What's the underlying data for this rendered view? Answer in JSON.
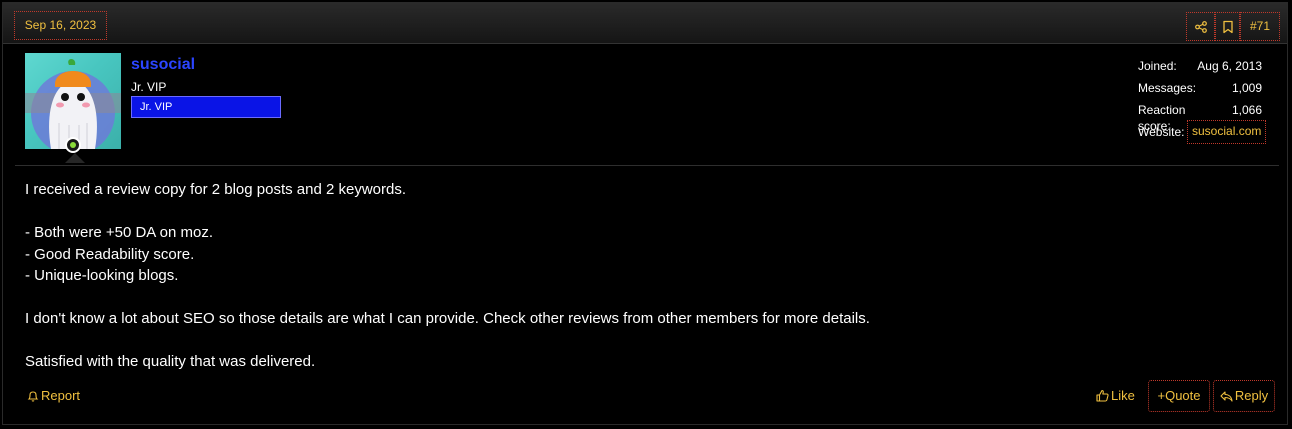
{
  "post": {
    "date": "Sep 16, 2023",
    "number": "#71",
    "share_icon": "share-icon",
    "bookmark_icon": "bookmark-icon"
  },
  "user": {
    "name": "susocial",
    "title": "Jr. VIP",
    "banner": "Jr. VIP",
    "online": true,
    "stats": {
      "joined_label": "Joined:",
      "joined_value": "Aug 6, 2013",
      "messages_label": "Messages:",
      "messages_value": "1,009",
      "reaction_label": "Reaction score:",
      "reaction_value": "1,066",
      "website_label": "Website:",
      "website_value": "susocial.com"
    }
  },
  "message": {
    "lines": [
      "I received a review copy for 2 blog posts and 2 keywords.",
      "",
      "- Both were +50 DA on moz.",
      "- Good Readability score.",
      "- Unique-looking blogs.",
      "",
      "I don't know a lot about SEO so those details are what I can provide. Check other reviews from other members for more details.",
      "",
      "Satisfied with the quality that was delivered."
    ]
  },
  "actions": {
    "report": "Report",
    "like": "Like",
    "quote": "Quote",
    "reply": "Reply"
  },
  "colors": {
    "accent": "#f0c040",
    "username": "#2b45ff",
    "banner_bg": "#0a14e6"
  }
}
